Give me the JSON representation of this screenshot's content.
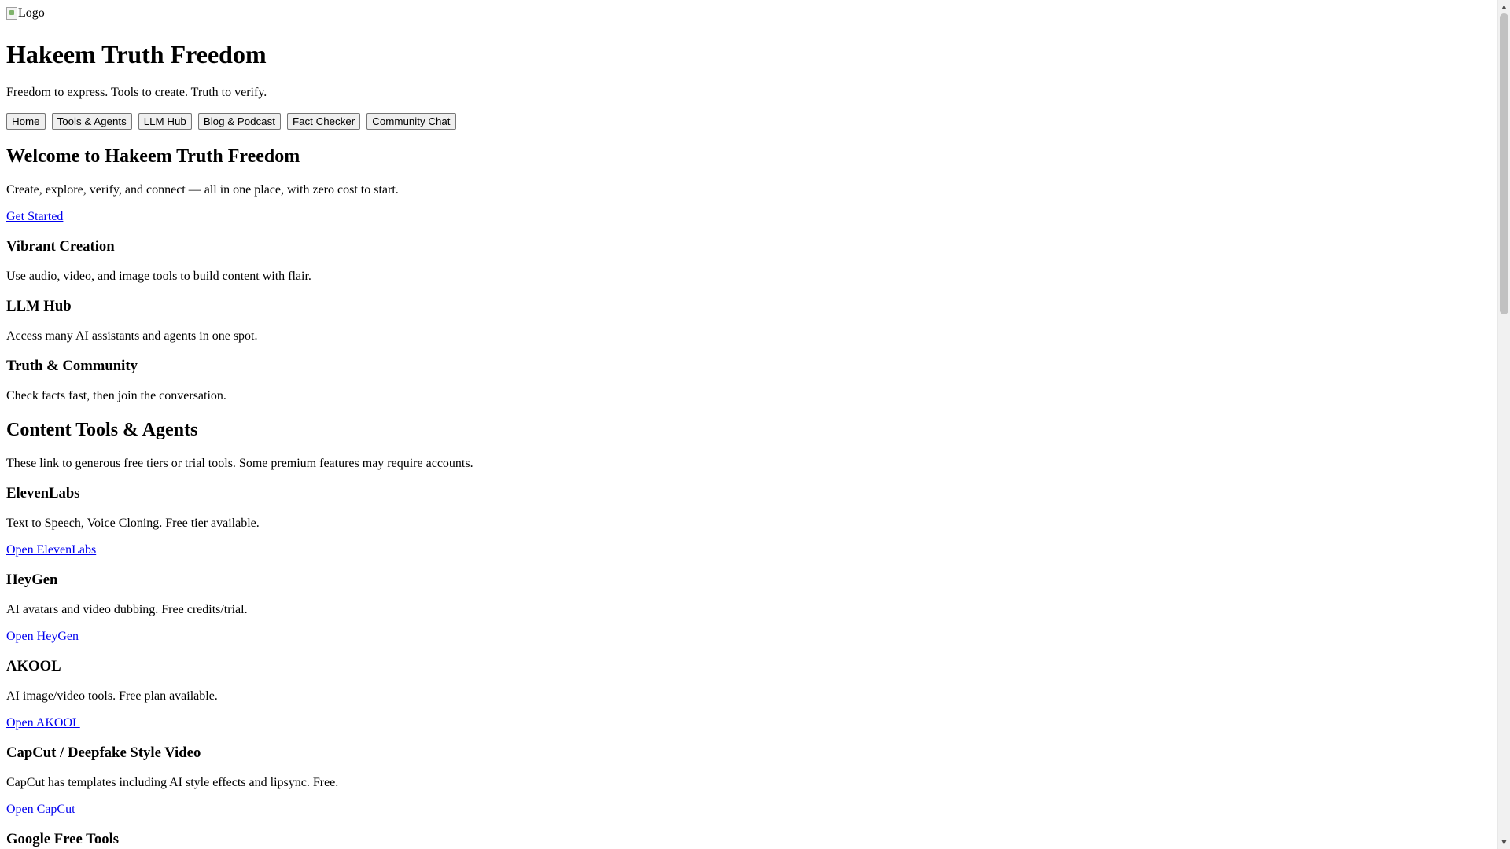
{
  "header": {
    "logo_alt": "Logo",
    "title": "Hakeem Truth Freedom",
    "tagline": "Freedom to express. Tools to create. Truth to verify."
  },
  "nav": {
    "items": [
      {
        "label": "Home"
      },
      {
        "label": "Tools & Agents"
      },
      {
        "label": "LLM Hub"
      },
      {
        "label": "Blog & Podcast"
      },
      {
        "label": "Fact Checker"
      },
      {
        "label": "Community Chat"
      }
    ]
  },
  "welcome": {
    "heading": "Welcome to Hakeem Truth Freedom",
    "text": "Create, explore, verify, and connect — all in one place, with zero cost to start.",
    "cta_label": "Get Started"
  },
  "features": [
    {
      "title": "Vibrant Creation",
      "text": "Use audio, video, and image tools to build content with flair."
    },
    {
      "title": "LLM Hub",
      "text": "Access many AI assistants and agents in one spot."
    },
    {
      "title": "Truth & Community",
      "text": "Check facts fast, then join the conversation."
    }
  ],
  "tools": {
    "heading": "Content Tools & Agents",
    "intro": "These link to generous free tiers or trial tools. Some premium features may require accounts.",
    "items": [
      {
        "name": "ElevenLabs",
        "text": "Text to Speech, Voice Cloning. Free tier available.",
        "link": "Open ElevenLabs"
      },
      {
        "name": "HeyGen",
        "text": "AI avatars and video dubbing. Free credits/trial.",
        "link": "Open HeyGen"
      },
      {
        "name": "AKOOL",
        "text": "AI image/video tools. Free plan available.",
        "link": "Open AKOOL"
      },
      {
        "name": "CapCut / Deepfake Style Video",
        "text": "CapCut has templates including AI style effects and lipsync. Free.",
        "link": "Open CapCut"
      }
    ],
    "next_heading": "Google Free Tools"
  },
  "icons": {
    "broken_image": "broken-image-icon",
    "scroll_up": "chevron-up-icon",
    "scroll_down": "chevron-down-icon"
  },
  "colors": {
    "link": "#0000ee",
    "button_bg": "#efefef",
    "button_border": "#767676"
  }
}
